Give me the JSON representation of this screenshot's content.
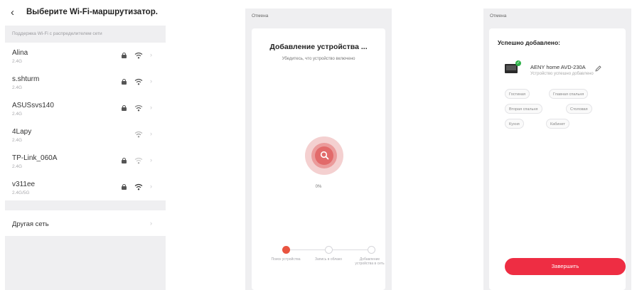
{
  "wifi_screen": {
    "back_icon": "chevron-left-icon",
    "title": "Выберите Wi-Fi-маршрутизатор.",
    "hint": "Поддержка Wi-Fi с распределителем сети",
    "networks": [
      {
        "name": "Alina",
        "band": "2.4G",
        "locked": true,
        "icon": "wifi-icon"
      },
      {
        "name": "s.shturm",
        "band": "2.4G",
        "locked": true,
        "icon": "wifi-icon"
      },
      {
        "name": "ASUSsvs140",
        "band": "2.4G",
        "locked": true,
        "icon": "wifi-icon"
      },
      {
        "name": "4Lapy",
        "band": "2.4G",
        "locked": false,
        "icon": "wifi-icon"
      },
      {
        "name": "TP-Link_060A",
        "band": "2.4G",
        "locked": true,
        "icon": "wifi-icon"
      },
      {
        "name": "v311ee",
        "band": "2.4G/5G",
        "locked": true,
        "icon": "wifi-icon"
      }
    ],
    "other_network": "Другая сеть"
  },
  "adding_screen": {
    "cancel": "Отмена",
    "title": "Добавление устройства ...",
    "subtitle": "Убедитесь, что устройство включено",
    "progress_text": "0%",
    "progress": 0,
    "steps": [
      {
        "label": "Поиск устройства",
        "state": "active"
      },
      {
        "label": "Запись в облако",
        "state": "idle"
      },
      {
        "label": "Добавление устройства в сеть",
        "state": "idle"
      }
    ],
    "accent_color": "#e95440"
  },
  "success_screen": {
    "cancel": "Отмена",
    "title": "Успешно добавлено:",
    "device_name": "AENY home AVD-230A",
    "device_status": "Устройство успешно добавлено",
    "rooms": [
      "Гостиная",
      "Главная спальня",
      "Вторая спальня",
      "Столовая",
      "Кухня",
      "Кабинет"
    ],
    "finish_button": "Завершить",
    "button_color": "#ee2d43"
  }
}
